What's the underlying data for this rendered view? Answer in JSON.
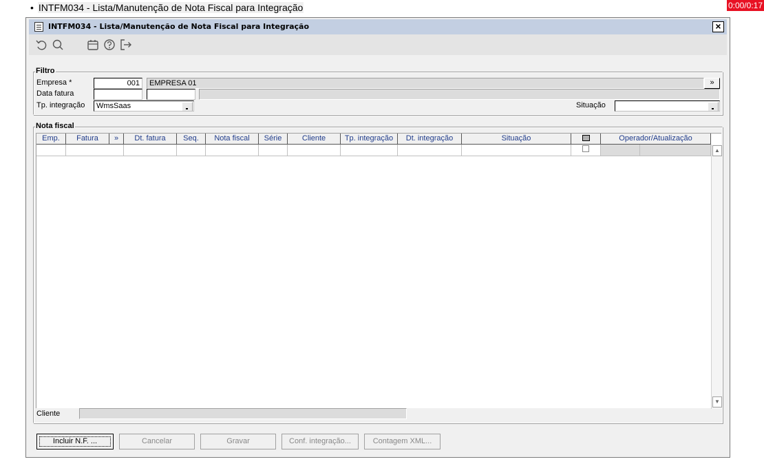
{
  "top_caption": "INTFM034 - Lista/Manutenção de Nota Fiscal para Integração",
  "timer": "0:00/0:17",
  "window": {
    "title": "INTFM034 - Lista/Manutenção de Nota Fiscal para Integração",
    "close": "×"
  },
  "toolbar": [
    "undo-icon",
    "search-icon",
    "calendar-icon",
    "help-icon",
    "exit-icon"
  ],
  "filtro": {
    "legend": "Filtro",
    "empresa_label": "Empresa *",
    "empresa_code": "001",
    "empresa_name": "EMPRESA 01",
    "more_button": "»",
    "data_fatura_label": "Data fatura",
    "data_fatura_from": "",
    "data_fatura_to": "",
    "tp_integracao_label": "Tp. integração",
    "tp_integracao_value": "WmsSaas",
    "situacao_label": "Situação",
    "situacao_value": ""
  },
  "nota_fiscal": {
    "legend": "Nota fiscal",
    "columns": [
      "Emp.",
      "Fatura",
      "»",
      "Dt. fatura",
      "Seq.",
      "Nota fiscal",
      "Série",
      "Cliente",
      "Tp. integração",
      "Dt. integração",
      "Situação",
      "",
      "Operador/Atualização"
    ],
    "cliente_label": "Cliente",
    "cliente_value": ""
  },
  "buttons": {
    "incluir": "Incluir N.F. ...",
    "cancelar": "Cancelar",
    "gravar": "Gravar",
    "conf_integracao": "Conf. integração...",
    "contagem_xml": "Contagem XML..."
  }
}
